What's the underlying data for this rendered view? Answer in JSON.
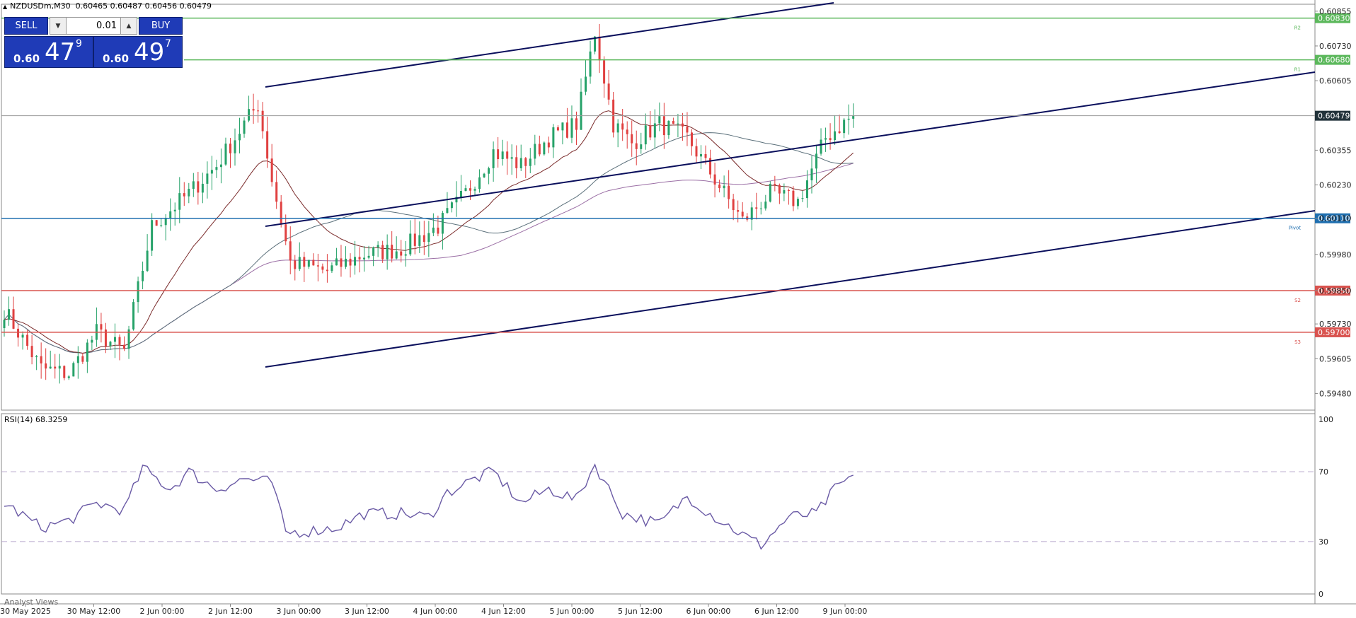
{
  "symbol_line": {
    "symbol": "NZDUSDm,M30",
    "ohlc": "0.60465 0.60487 0.60456 0.60479"
  },
  "trade_panel": {
    "sell_label": "SELL",
    "buy_label": "BUY",
    "lot": "0.01",
    "sell_prefix": "0.60",
    "sell_big": "47",
    "sell_sup": "9",
    "buy_prefix": "0.60",
    "buy_big": "49",
    "buy_sup": "7",
    "color": "#1f3bb7"
  },
  "rsi_label": "RSI(14) 68.3259",
  "analyst_label": "Analyst Views",
  "chart_data": [
    {
      "type": "candlestick",
      "title": "NZDUSDm,M30",
      "ylim": [
        0.5942,
        0.6088
      ],
      "price_ticks": [
        "0.60855",
        "0.60730",
        "0.60605",
        "0.60479",
        "0.60355",
        "0.60230",
        "0.60110",
        "0.59980",
        "0.59850",
        "0.59730",
        "0.59605",
        "0.59480"
      ],
      "current_price": "0.60479",
      "x_ticks": [
        "30 May 2025",
        "30 May 12:00",
        "2 Jun 00:00",
        "2 Jun 12:00",
        "3 Jun 00:00",
        "3 Jun 12:00",
        "4 Jun 00:00",
        "4 Jun 12:00",
        "5 Jun 00:00",
        "5 Jun 12:00",
        "6 Jun 00:00",
        "6 Jun 12:00",
        "9 Jun 00:00"
      ],
      "colors": {
        "up": "#26a269",
        "down": "#e04040",
        "grid": "#888888"
      },
      "key_points": [
        {
          "x": 0,
          "close": 0.5978
        },
        {
          "x": 8,
          "close": 0.5957
        },
        {
          "x": 14,
          "close": 0.5955
        },
        {
          "x": 20,
          "close": 0.597
        },
        {
          "x": 26,
          "close": 0.5963
        },
        {
          "x": 32,
          "close": 0.6008
        },
        {
          "x": 40,
          "close": 0.602
        },
        {
          "x": 46,
          "close": 0.603
        },
        {
          "x": 52,
          "close": 0.6045
        },
        {
          "x": 55,
          "close": 0.6052
        },
        {
          "x": 58,
          "close": 0.6025
        },
        {
          "x": 62,
          "close": 0.5995
        },
        {
          "x": 70,
          "close": 0.5992
        },
        {
          "x": 78,
          "close": 0.5998
        },
        {
          "x": 86,
          "close": 0.6
        },
        {
          "x": 94,
          "close": 0.6008
        },
        {
          "x": 100,
          "close": 0.602
        },
        {
          "x": 106,
          "close": 0.6035
        },
        {
          "x": 112,
          "close": 0.603
        },
        {
          "x": 118,
          "close": 0.604
        },
        {
          "x": 124,
          "close": 0.6045
        },
        {
          "x": 128,
          "close": 0.6078
        },
        {
          "x": 132,
          "close": 0.6045
        },
        {
          "x": 136,
          "close": 0.6038
        },
        {
          "x": 142,
          "close": 0.6045
        },
        {
          "x": 148,
          "close": 0.604
        },
        {
          "x": 154,
          "close": 0.6025
        },
        {
          "x": 160,
          "close": 0.601
        },
        {
          "x": 166,
          "close": 0.602
        },
        {
          "x": 172,
          "close": 0.6017
        },
        {
          "x": 178,
          "close": 0.604
        },
        {
          "x": 184,
          "close": 0.6048
        }
      ],
      "levels": [
        {
          "price": 0.6083,
          "label": "0.60830",
          "tag": "R2",
          "color": "#5cb85c"
        },
        {
          "price": 0.6068,
          "label": "0.60680",
          "tag": "R1",
          "color": "#5cb85c"
        },
        {
          "price": 0.6011,
          "label": "0.60110",
          "tag": "Pivot",
          "color": "#1f6fb0"
        },
        {
          "price": 0.5985,
          "label": "0.59850",
          "tag": "S2",
          "color": "#d9534f"
        },
        {
          "price": 0.597,
          "label": "0.59700",
          "tag": "S3",
          "color": "#d9534f"
        }
      ]
    },
    {
      "type": "line",
      "title": "RSI(14) 68.3259",
      "ylim": [
        0,
        100
      ],
      "y_ticks": [
        "100",
        "70",
        "30",
        "0"
      ],
      "key_points": [
        {
          "x": 0,
          "rsi": 52
        },
        {
          "x": 8,
          "rsi": 38
        },
        {
          "x": 14,
          "rsi": 42
        },
        {
          "x": 20,
          "rsi": 52
        },
        {
          "x": 26,
          "rsi": 48
        },
        {
          "x": 30,
          "rsi": 72
        },
        {
          "x": 36,
          "rsi": 60
        },
        {
          "x": 40,
          "rsi": 70
        },
        {
          "x": 46,
          "rsi": 60
        },
        {
          "x": 52,
          "rsi": 66
        },
        {
          "x": 58,
          "rsi": 64
        },
        {
          "x": 61,
          "rsi": 35
        },
        {
          "x": 66,
          "rsi": 36
        },
        {
          "x": 72,
          "rsi": 38
        },
        {
          "x": 78,
          "rsi": 46
        },
        {
          "x": 86,
          "rsi": 46
        },
        {
          "x": 92,
          "rsi": 44
        },
        {
          "x": 96,
          "rsi": 58
        },
        {
          "x": 102,
          "rsi": 66
        },
        {
          "x": 106,
          "rsi": 70
        },
        {
          "x": 112,
          "rsi": 52
        },
        {
          "x": 118,
          "rsi": 60
        },
        {
          "x": 124,
          "rsi": 54
        },
        {
          "x": 128,
          "rsi": 74
        },
        {
          "x": 134,
          "rsi": 46
        },
        {
          "x": 142,
          "rsi": 40
        },
        {
          "x": 148,
          "rsi": 56
        },
        {
          "x": 154,
          "rsi": 44
        },
        {
          "x": 160,
          "rsi": 34
        },
        {
          "x": 164,
          "rsi": 28
        },
        {
          "x": 170,
          "rsi": 44
        },
        {
          "x": 176,
          "rsi": 46
        },
        {
          "x": 180,
          "rsi": 60
        },
        {
          "x": 184,
          "rsi": 68
        }
      ]
    }
  ]
}
